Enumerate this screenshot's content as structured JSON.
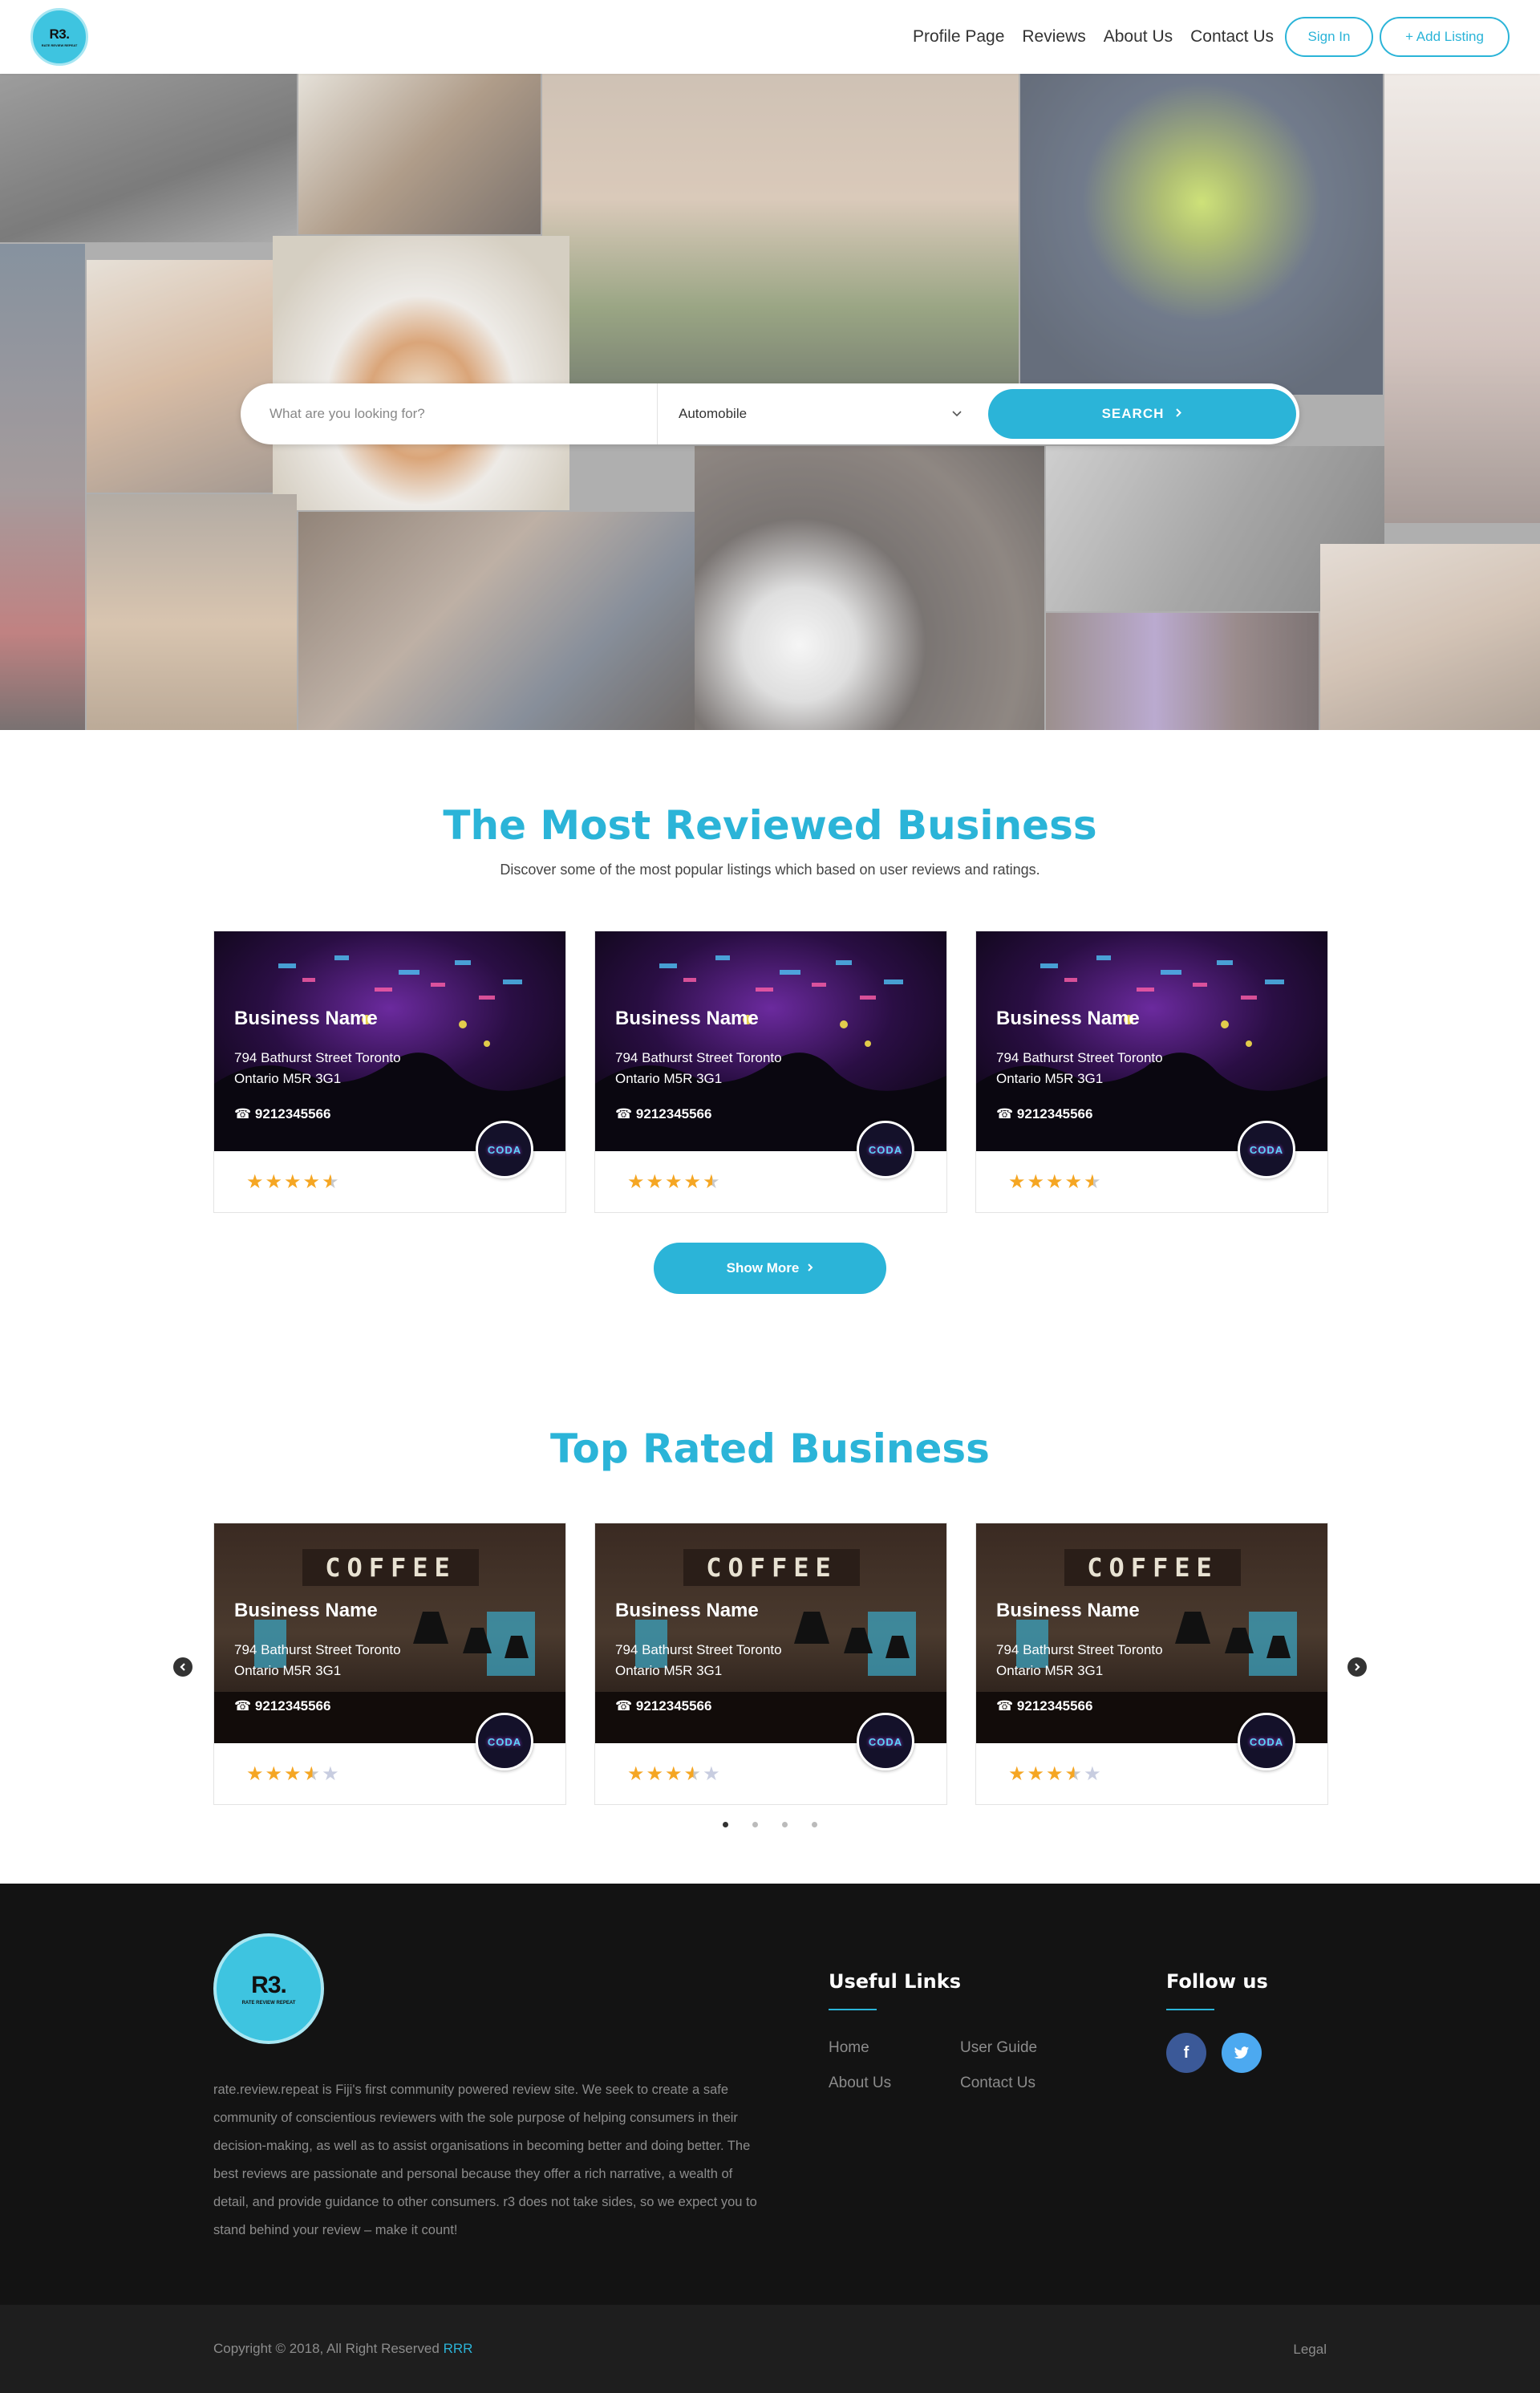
{
  "nav": {
    "logo_text": "R3.",
    "logo_tagline": "RATE REVIEW REPEAT",
    "links": [
      "Profile Page",
      "Reviews",
      "About Us",
      "Contact Us"
    ],
    "sign_in": "Sign In",
    "add_listing": "+ Add Listing"
  },
  "search": {
    "placeholder": "What are you looking for?",
    "category": "Automobile",
    "button": "SEARCH"
  },
  "most_reviewed": {
    "title": "The Most Reviewed Business",
    "subtitle": "Discover some of the most popular listings which based on user reviews and ratings.",
    "cards": [
      {
        "name": "Business Name",
        "address_line1": "794 Bathurst Street Toronto",
        "address_line2": "Ontario M5R 3G1",
        "phone": "9212345566",
        "badge": "CODA",
        "rating": 4.5
      },
      {
        "name": "Business Name",
        "address_line1": "794 Bathurst Street Toronto",
        "address_line2": "Ontario M5R 3G1",
        "phone": "9212345566",
        "badge": "CODA",
        "rating": 4.5
      },
      {
        "name": "Business Name",
        "address_line1": "794 Bathurst Street Toronto",
        "address_line2": "Ontario M5R 3G1",
        "phone": "9212345566",
        "badge": "CODA",
        "rating": 4.5
      }
    ],
    "show_more": "Show More"
  },
  "top_rated": {
    "title": "Top Rated Business",
    "sign_text": "COFFEE",
    "cards": [
      {
        "name": "Business Name",
        "address_line1": "794 Bathurst Street Toronto",
        "address_line2": "Ontario M5R 3G1",
        "phone": "9212345566",
        "badge": "CODA",
        "rating": 3.5
      },
      {
        "name": "Business Name",
        "address_line1": "794 Bathurst Street Toronto",
        "address_line2": "Ontario M5R 3G1",
        "phone": "9212345566",
        "badge": "CODA",
        "rating": 3.5
      },
      {
        "name": "Business Name",
        "address_line1": "794 Bathurst Street Toronto",
        "address_line2": "Ontario M5R 3G1",
        "phone": "9212345566",
        "badge": "CODA",
        "rating": 3.5
      }
    ],
    "carousel_pages": 4,
    "active_page": 1
  },
  "footer": {
    "logo_text": "R3.",
    "logo_tagline": "RATE REVIEW REPEAT",
    "about": "rate.review.repeat is Fiji's first community powered review site. We seek to create a safe community of conscientious reviewers with the sole purpose of helping consumers in their decision-making, as well as to assist organisations in becoming better and doing better. The best reviews are passionate and personal because they offer a rich narrative, a wealth of detail, and provide guidance to other consumers. r3 does not take sides, so we expect you to stand behind your review – make it count!",
    "useful_links_title": "Useful Links",
    "useful_links": [
      "Home",
      "User Guide",
      "About Us",
      "Contact Us"
    ],
    "follow_title": "Follow us",
    "facebook": "f",
    "twitter": "t",
    "copyright": "Copyright © 2018, All Right Reserved",
    "copyright_brand": "RRR",
    "legal": "Legal"
  },
  "colors": {
    "accent": "#2bb4d8",
    "star": "#f5a623",
    "footer_bg": "#131313",
    "facebook": "#3b5998",
    "twitter": "#4ca9f0"
  }
}
